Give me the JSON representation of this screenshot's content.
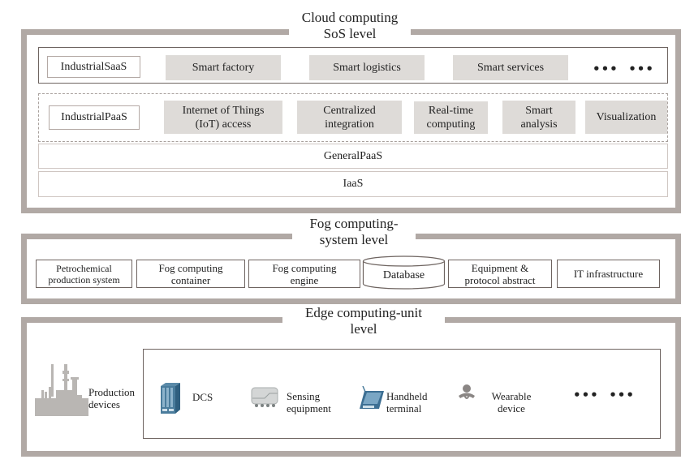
{
  "cloud": {
    "title_line1": "Cloud computing",
    "title_line2": "SoS level",
    "saas": {
      "label": "IndustrialSaaS",
      "items": [
        "Smart factory",
        "Smart logistics",
        "Smart services"
      ],
      "more": "•••  •••"
    },
    "paas": {
      "label": "IndustrialPaaS",
      "items": [
        {
          "line1": "Internet of Things",
          "line2": "(IoT) access"
        },
        {
          "line1": "Centralized",
          "line2": "integration"
        },
        {
          "line1": "Real-time",
          "line2": "computing"
        },
        {
          "line1": "Smart",
          "line2": "analysis"
        },
        {
          "line1": "Visualization",
          "line2": ""
        }
      ]
    },
    "general_paas": "GeneralPaaS",
    "iaas": "IaaS"
  },
  "fog": {
    "title_line1": "Fog computing-",
    "title_line2": "system level",
    "items": [
      {
        "line1": "Petrochemical",
        "line2": "production system"
      },
      {
        "line1": "Fog computing",
        "line2": "container"
      },
      {
        "line1": "Fog computing",
        "line2": "engine"
      },
      {
        "line1": "Database",
        "line2": ""
      },
      {
        "line1": "Equipment &",
        "line2": "protocol abstract"
      },
      {
        "line1": "IT infrastructure",
        "line2": ""
      }
    ]
  },
  "edge": {
    "title_line1": "Edge computing-unit",
    "title_line2": "level",
    "production": {
      "line1": "Production",
      "line2": "devices",
      "icon": "factory-icon"
    },
    "devices": [
      {
        "line1": "DCS",
        "line2": "",
        "icon": "dcs-cabinet-icon"
      },
      {
        "line1": "Sensing",
        "line2": "equipment",
        "icon": "sensor-icon"
      },
      {
        "line1": "Handheld",
        "line2": "terminal",
        "icon": "handheld-terminal-icon"
      },
      {
        "line1": "Wearable",
        "line2": "device",
        "icon": "wearable-device-icon"
      }
    ],
    "more": "•••  •••"
  },
  "colors": {
    "frame": "#b1a9a5",
    "gray_box": "#dedbd8",
    "device_blue": "#3f6f8f"
  }
}
